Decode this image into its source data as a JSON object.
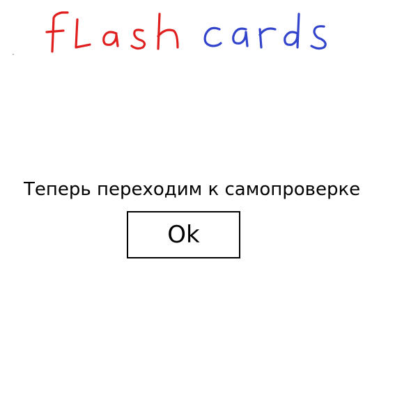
{
  "logo": {
    "text": "flash cards",
    "words": [
      {
        "text": "flash",
        "color": "#e01e1e"
      },
      {
        "text": "cards",
        "color": "#3344cc"
      }
    ]
  },
  "dialog": {
    "message": "Теперь переходим к самопроверке",
    "ok_label": "Ok"
  }
}
